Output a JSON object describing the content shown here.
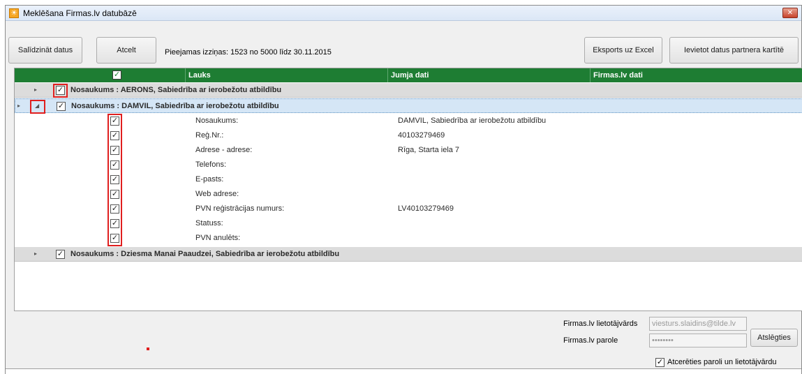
{
  "window": {
    "title": "Meklēšana Firmas.lv datubāzē",
    "close_glyph": "✕"
  },
  "toolbar": {
    "compare_label": "Salīdzināt datus",
    "cancel_label": "Atcelt",
    "quota_text": "Pieejamas izziņas: 1523 no 5000 līdz 30.11.2015",
    "export_label": "Eksports uz Excel",
    "import_label": "Ievietot datus partnera kartītē"
  },
  "grid": {
    "header": {
      "field": "Lauks",
      "jumis": "Jumja dati",
      "firmas": "Firmas.lv dati"
    },
    "groups": [
      {
        "label": "Nosaukums : AERONS, Sabiedrība ar ierobežotu atbildību"
      },
      {
        "label": "Nosaukums : DAMVIL, Sabiedrība ar ierobežotu atbildību"
      },
      {
        "label": "Nosaukums : Dziesma Manai Paaudzei, Sabiedrība ar ierobežotu atbildību"
      }
    ],
    "details": [
      {
        "field": "Nosaukums:",
        "value": "DAMVIL, Sabiedrība ar ierobežotu atbildību"
      },
      {
        "field": "Reģ.Nr.:",
        "value": "40103279469"
      },
      {
        "field": "Adrese - adrese:",
        "value": "Rīga, Starta iela 7"
      },
      {
        "field": "Telefons:",
        "value": ""
      },
      {
        "field": "E-pasts:",
        "value": ""
      },
      {
        "field": "Web adrese:",
        "value": ""
      },
      {
        "field": "PVN reģistrācijas numurs:",
        "value": "LV40103279469"
      },
      {
        "field": "Statuss:",
        "value": ""
      },
      {
        "field": "PVN anulēts:",
        "value": ""
      }
    ]
  },
  "footer": {
    "username_label": "Firmas.lv lietotājvārds",
    "username_value": "viesturs.slaidins@tilde.lv",
    "password_label": "Firmas.lv parole",
    "password_value": "••••••••",
    "disconnect_label": "Atslēgties",
    "remember_label": "Atcerēties paroli un lietotājvārdu"
  },
  "glyphs": {
    "check": "✓",
    "expand_collapsed": "▸",
    "expand_open": "◢",
    "row_pointer": "▸"
  },
  "colors": {
    "header_green": "#1e7d33",
    "highlight_red": "#e01f1f",
    "selected_row": "#d5e6f6"
  }
}
